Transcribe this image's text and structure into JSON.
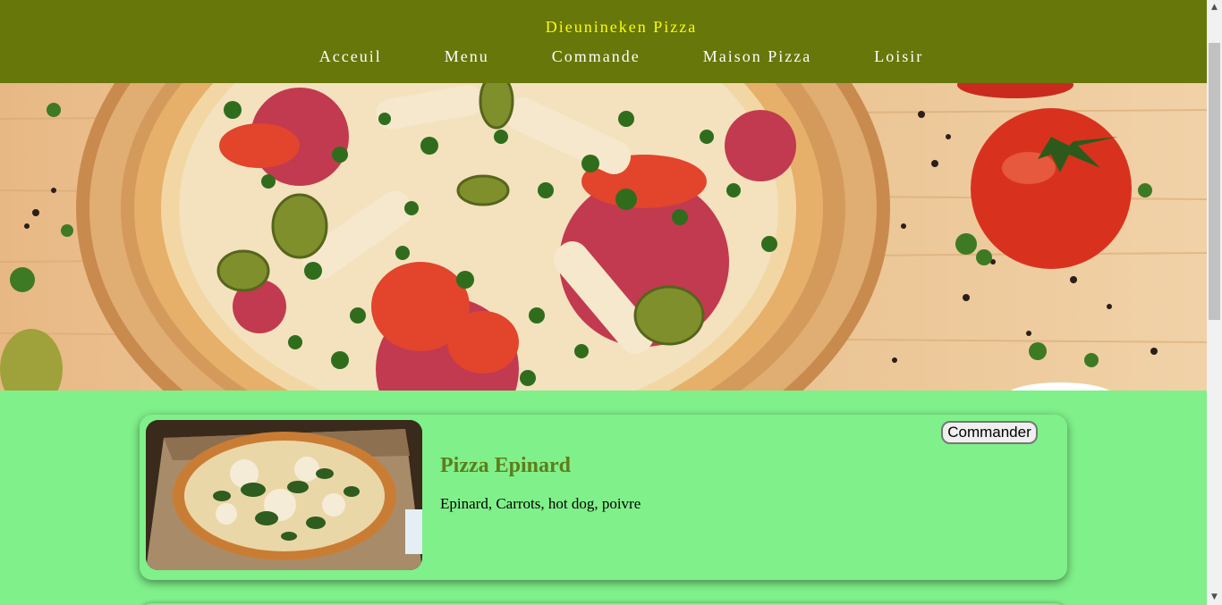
{
  "header": {
    "brand": "Dieunineken Pizza",
    "nav": [
      "Acceuil",
      "Menu",
      "Commande",
      "Maison Pizza",
      "Loisir"
    ]
  },
  "hero": {
    "image": "pizza-hero-image"
  },
  "products": [
    {
      "title": "Pizza Epinard",
      "description": "Epinard, Carrots, hot dog, poivre",
      "button": "Commander",
      "image": "pizza-box-photo"
    }
  ],
  "scrollbar": {
    "up": "▲",
    "down": "▼"
  },
  "colors": {
    "header_bg": "#67770a",
    "brand": "#ffff00",
    "page_bg": "#80f08a",
    "title": "#5e7d1a"
  }
}
